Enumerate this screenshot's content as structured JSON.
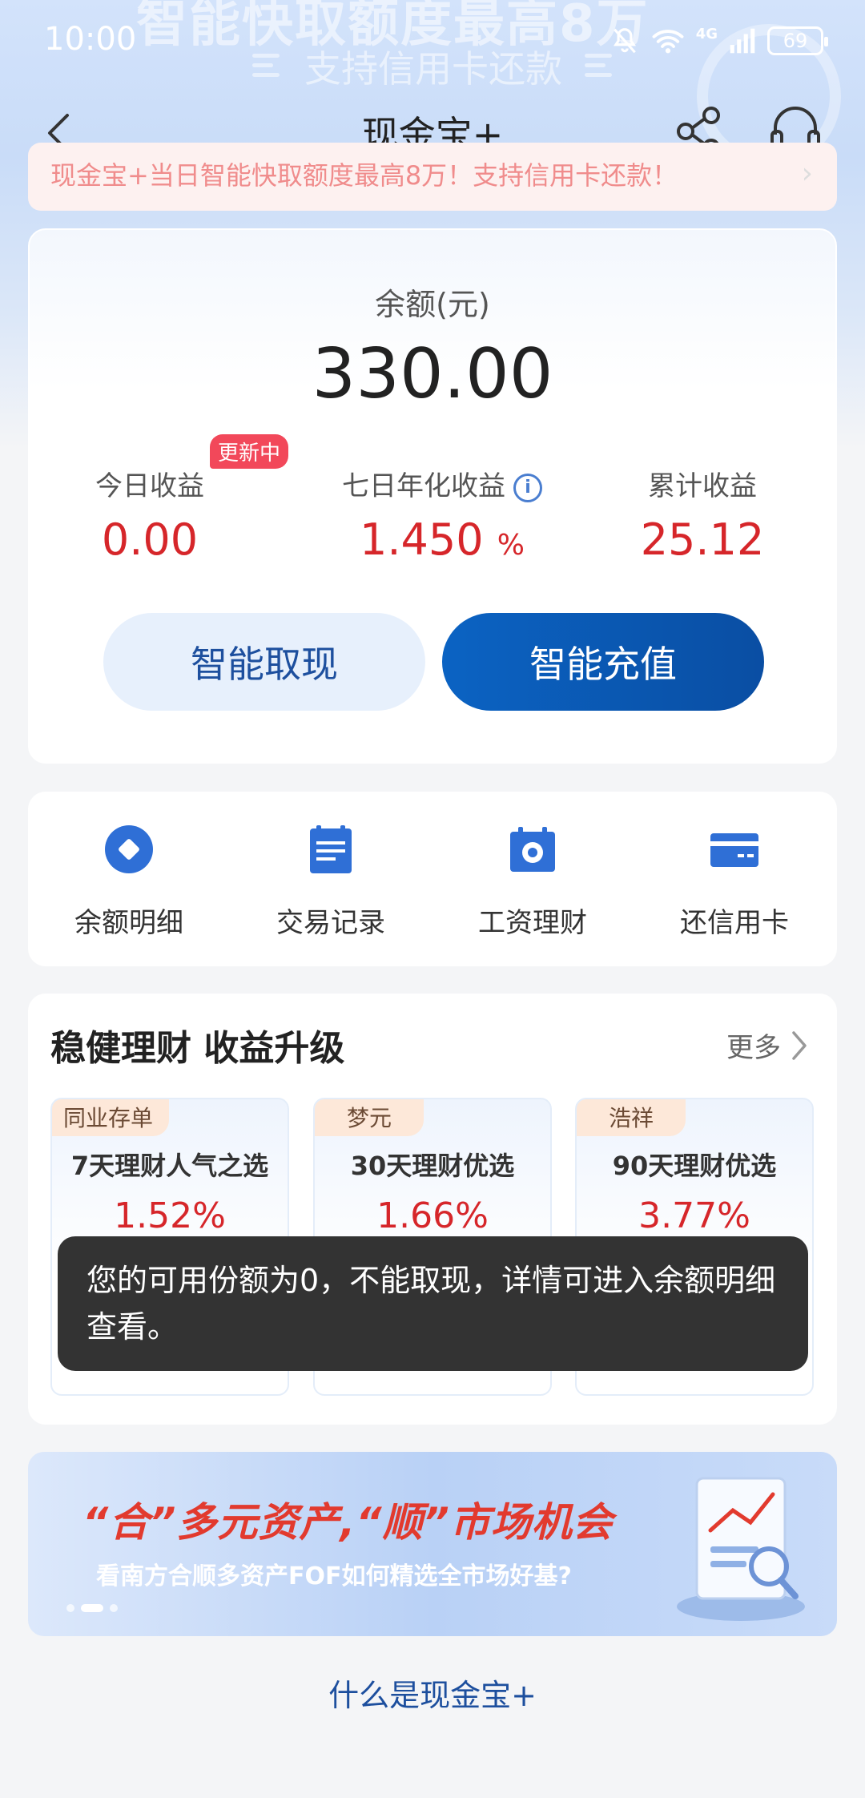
{
  "status_bar": {
    "time": "10:00",
    "network": "4G",
    "battery": "69"
  },
  "hero_bg": {
    "headline": "智能快取额度最高8万",
    "sub": "支持信用卡还款"
  },
  "nav": {
    "title": "现金宝+"
  },
  "marquee": {
    "text": "现金宝+当日智能快取额度最高8万！支持信用卡还款！"
  },
  "balance": {
    "label": "余额(元)",
    "amount": "330.00",
    "stats": [
      {
        "label": "今日收益",
        "value": "0.00",
        "badge": "更新中"
      },
      {
        "label": "七日年化收益",
        "value": "1.450",
        "unit": "%"
      },
      {
        "label": "累计收益",
        "value": "25.12"
      }
    ],
    "withdraw_label": "智能取现",
    "deposit_label": "智能充值"
  },
  "menu": [
    {
      "label": "余额明细",
      "icon": "balance-detail-icon"
    },
    {
      "label": "交易记录",
      "icon": "transaction-record-icon"
    },
    {
      "label": "工资理财",
      "icon": "salary-finance-icon"
    },
    {
      "label": "还信用卡",
      "icon": "credit-card-icon"
    }
  ],
  "wealth": {
    "title": "稳健理财 收益升级",
    "more": "更多",
    "products": [
      {
        "tag": "同业存单",
        "name": "7天理财人气之选",
        "rate": "1.52%"
      },
      {
        "tag": "梦元",
        "name": "30天理财优选",
        "rate": "1.66%"
      },
      {
        "tag": "浩祥",
        "name": "90天理财优选",
        "rate": "3.77%"
      }
    ]
  },
  "toast": {
    "message": "您的可用份额为0，不能取现，详情可进入余额明细查看。"
  },
  "banner": {
    "title": "“合”多元资产,“顺”市场机会",
    "subtitle": "看南方合顺多资产FOF如何精选全市场好基?"
  },
  "faq_link": "什么是现金宝+",
  "colors": {
    "accent": "#0b63c3",
    "profit_red": "#d6262a",
    "link_blue": "#1d4f9e"
  }
}
